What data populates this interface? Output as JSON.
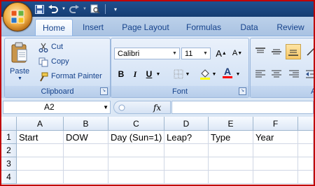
{
  "qat": {
    "icons": [
      "save-icon",
      "undo-icon",
      "redo-icon",
      "print-preview-icon",
      "customize-icon"
    ]
  },
  "tabs": [
    {
      "label": "Home",
      "active": true
    },
    {
      "label": "Insert"
    },
    {
      "label": "Page Layout"
    },
    {
      "label": "Formulas"
    },
    {
      "label": "Data"
    },
    {
      "label": "Review"
    }
  ],
  "clipboard": {
    "paste": "Paste",
    "cut": "Cut",
    "copy": "Copy",
    "format_painter": "Format Painter",
    "group_label": "Clipboard"
  },
  "font": {
    "family": "Calibri",
    "size": "11",
    "group_label": "Font",
    "bold": "B",
    "italic": "I",
    "underline": "U",
    "grow": "A",
    "shrink": "A",
    "color": "A",
    "font_color": "#ff0000",
    "fill_color": "#ffff00"
  },
  "alignment": {
    "group_label": "A"
  },
  "formula_bar": {
    "name_box": "A2",
    "fx": "fx",
    "value": ""
  },
  "grid": {
    "columns": [
      "A",
      "B",
      "C",
      "D",
      "E",
      "F"
    ],
    "rows": [
      {
        "num": "1",
        "cells": [
          "Start",
          "DOW",
          "Day (Sun=1)",
          "Leap?",
          "Type",
          "Year"
        ]
      },
      {
        "num": "2",
        "cells": [
          "",
          "",
          "",
          "",
          "",
          ""
        ]
      },
      {
        "num": "3",
        "cells": [
          "",
          "",
          "",
          "",
          "",
          ""
        ]
      },
      {
        "num": "4",
        "cells": [
          "",
          "",
          "",
          "",
          "",
          ""
        ]
      }
    ]
  }
}
